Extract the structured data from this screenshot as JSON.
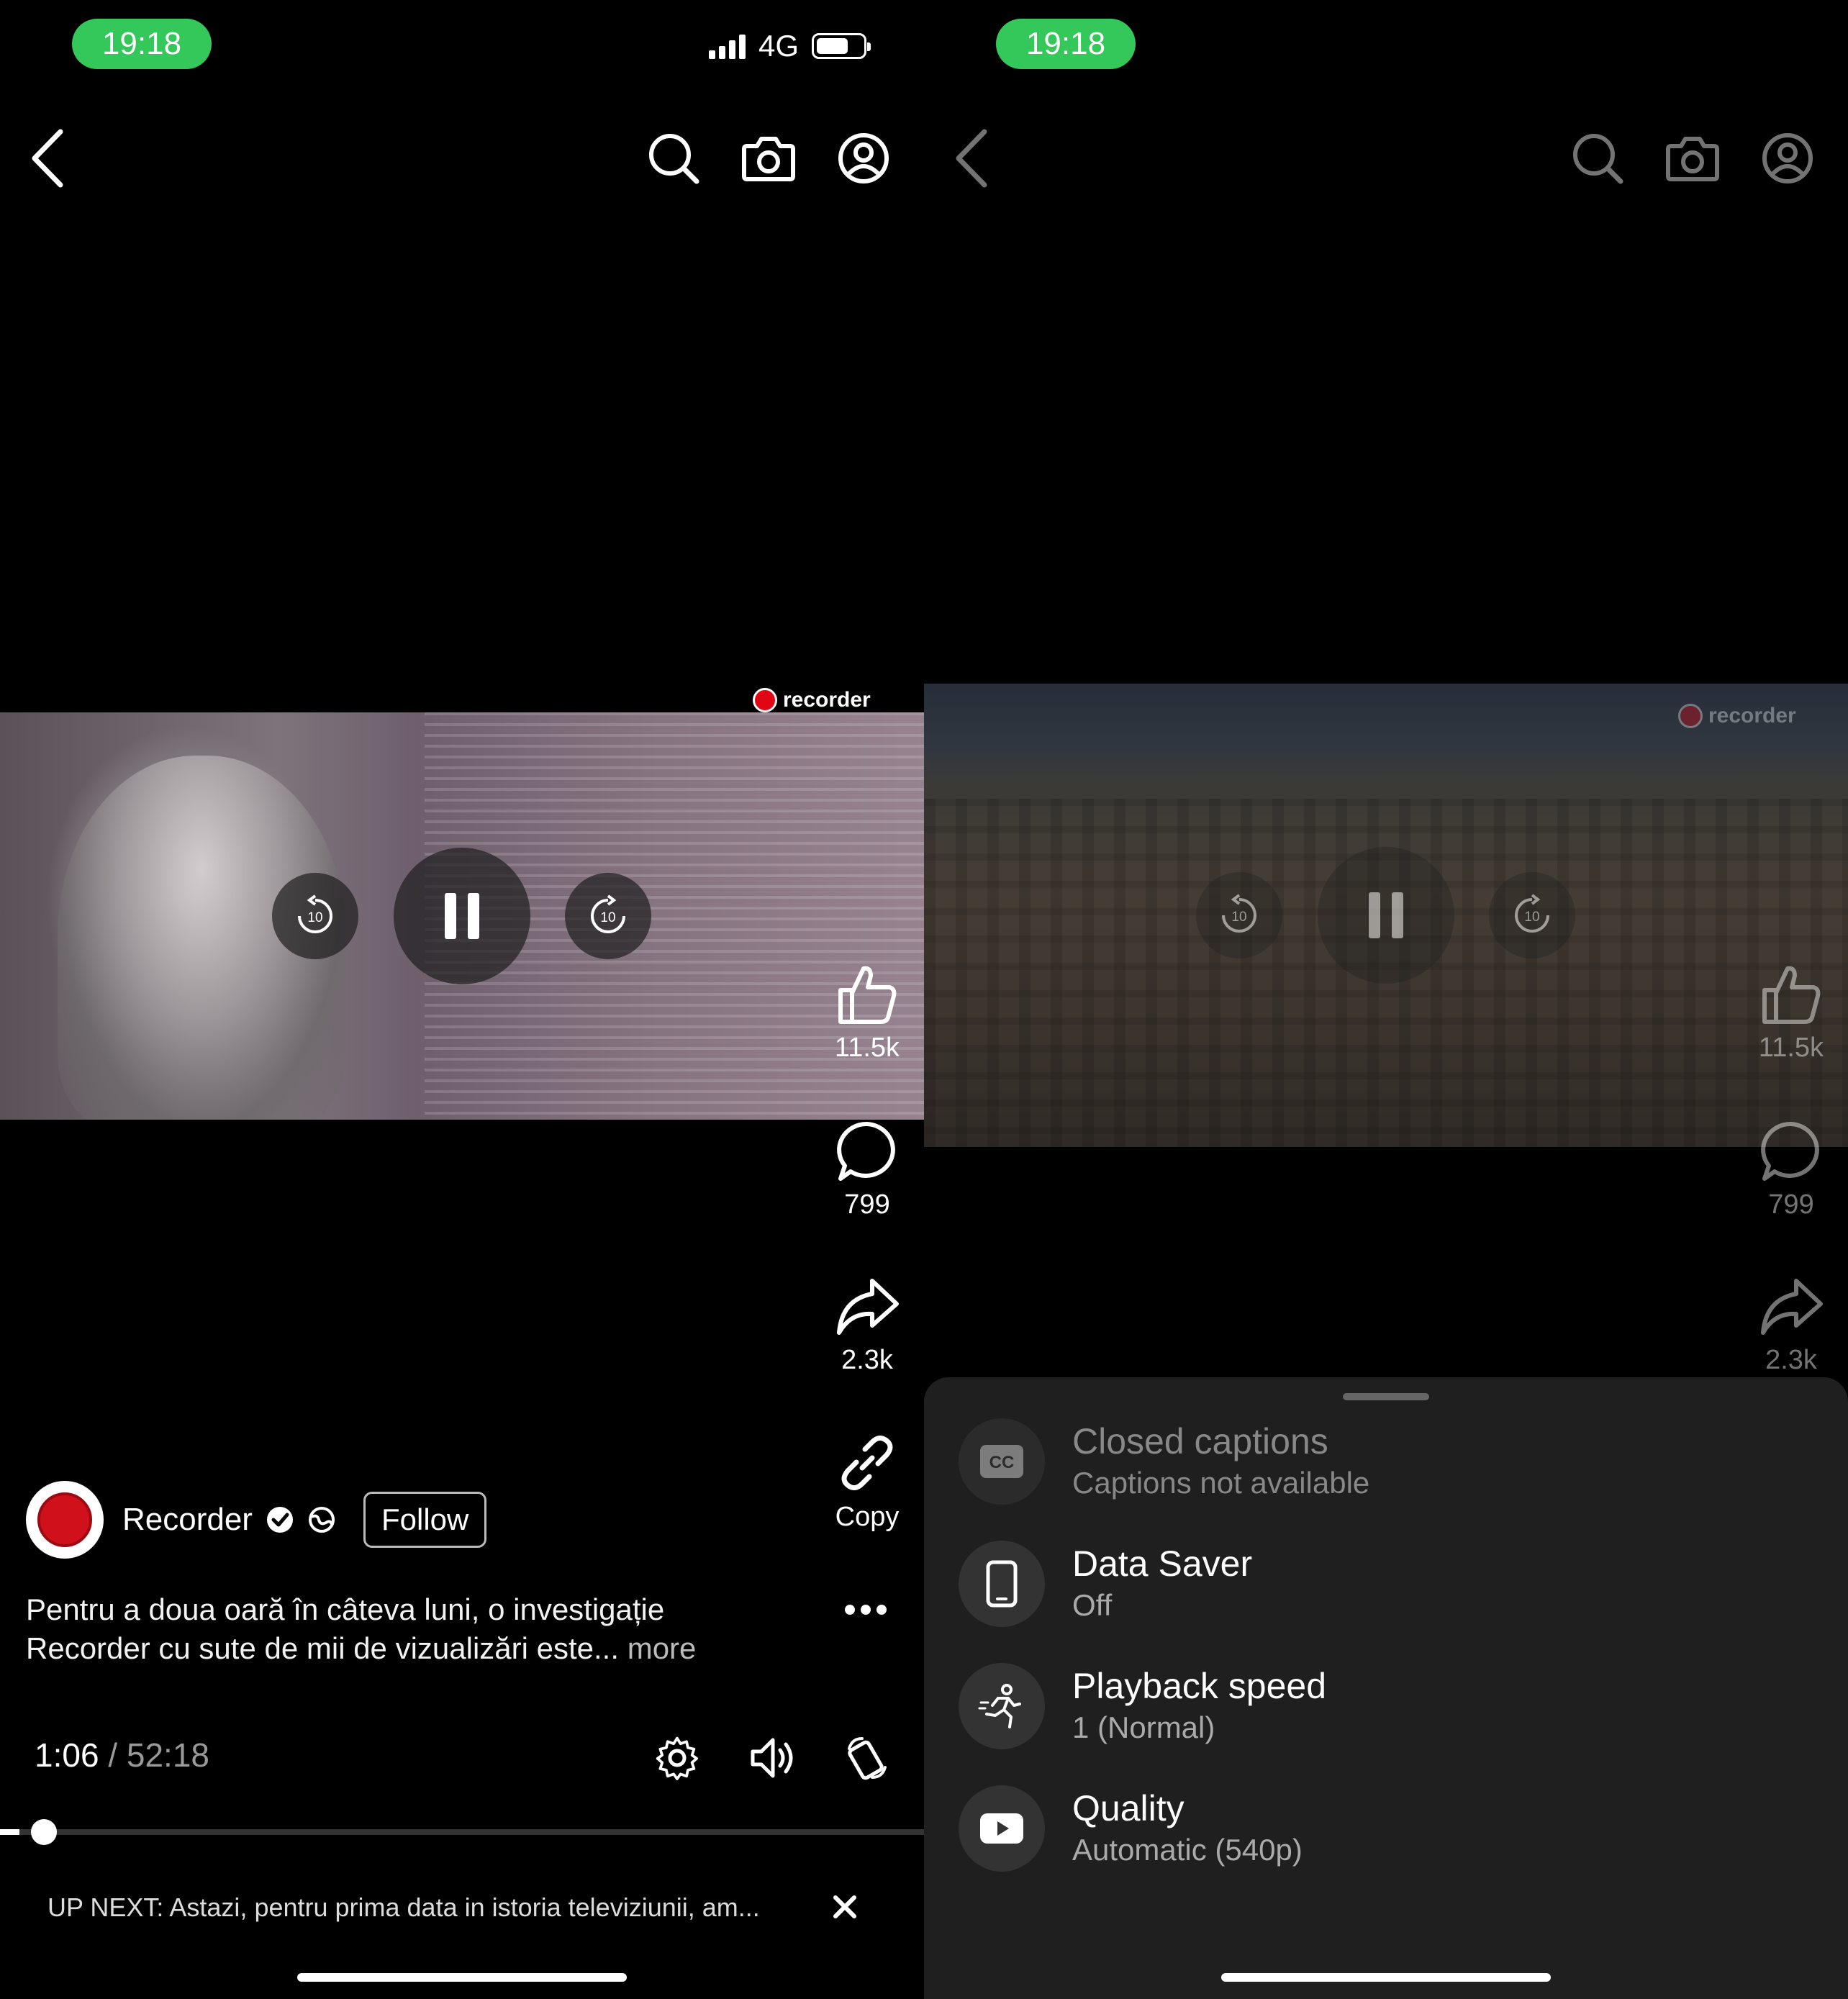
{
  "status": {
    "time": "19:18",
    "network": "4G"
  },
  "actions": {
    "likes": "11.5k",
    "comments": "799",
    "shares": "2.3k",
    "copy_label": "Copy"
  },
  "channel": {
    "name": "Recorder",
    "follow_label": "Follow"
  },
  "description": {
    "line1": "Pentru a doua oară în câteva luni, o investigație",
    "line2": "Recorder cu sute de mii de vizualizări este...",
    "more": "more"
  },
  "player": {
    "current_time": "1:06",
    "separator": "/",
    "duration": "52:18",
    "progress_fraction": 0.021,
    "watermark": "recorder",
    "skip_seconds": "10"
  },
  "up_next": {
    "text": "UP NEXT: Astazi, pentru prima data in istoria televiziunii, am..."
  },
  "settings_sheet": {
    "options": [
      {
        "icon": "cc-icon",
        "title": "Closed captions",
        "subtitle": "Captions not available",
        "enabled": false
      },
      {
        "icon": "phone-icon",
        "title": "Data Saver",
        "subtitle": "Off",
        "enabled": true
      },
      {
        "icon": "running-figure-icon",
        "title": "Playback speed",
        "subtitle": "1 (Normal)",
        "enabled": true
      },
      {
        "icon": "youtube-play-icon",
        "title": "Quality",
        "subtitle": "Automatic (540p)",
        "enabled": true
      }
    ]
  },
  "colors": {
    "status_pill": "#34c759",
    "brand_red": "#e10613",
    "sheet_bg": "#1f1f1f"
  }
}
